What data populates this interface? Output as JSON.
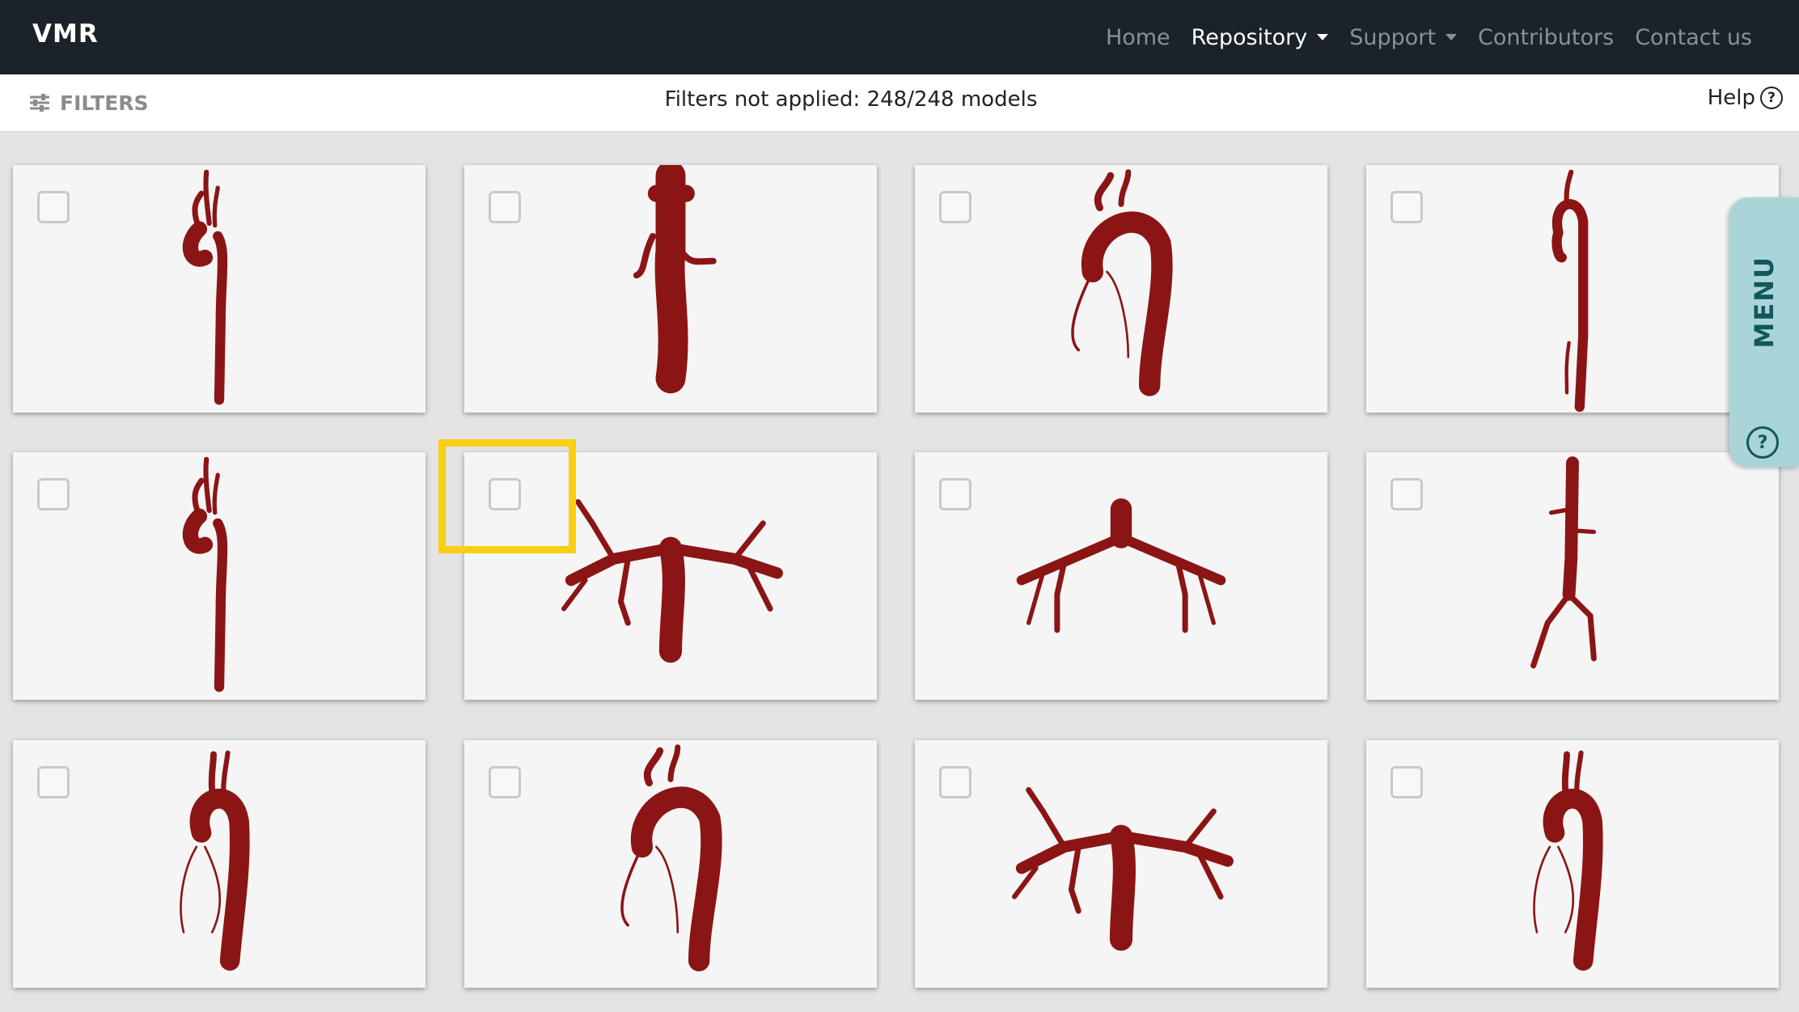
{
  "navbar": {
    "brand": "VMR",
    "links": [
      {
        "label": "Home",
        "active": false,
        "dropdown": false
      },
      {
        "label": "Repository",
        "active": true,
        "dropdown": true
      },
      {
        "label": "Support",
        "active": false,
        "dropdown": true
      },
      {
        "label": "Contributors",
        "active": false,
        "dropdown": false
      },
      {
        "label": "Contact us",
        "active": false,
        "dropdown": false
      }
    ]
  },
  "filterbar": {
    "filters_label": "FILTERS",
    "status": "Filters not applied: 248/248 models",
    "help_label": "Help"
  },
  "side_menu": {
    "label": "MENU",
    "help_icon": "question-circle-icon"
  },
  "colors": {
    "navbar_bg": "#1a2329",
    "vessel": "#8b1515",
    "highlight": "#f8cf12",
    "menu_tab": "#a9d5d8"
  },
  "models": [
    {
      "icon": "aorta-model-icon",
      "checked": false
    },
    {
      "icon": "vena-cava-model-icon",
      "checked": false
    },
    {
      "icon": "aortic-arch-coronary-model-icon",
      "checked": false
    },
    {
      "icon": "thoracic-aorta-model-icon",
      "checked": false
    },
    {
      "icon": "aorta-model-icon",
      "checked": false
    },
    {
      "icon": "pulmonary-tree-model-icon",
      "checked": false
    },
    {
      "icon": "pulmonary-arteries-model-icon",
      "checked": false
    },
    {
      "icon": "abdominal-aorta-model-icon",
      "checked": false
    },
    {
      "icon": "aortic-root-coronary-model-icon",
      "checked": false
    },
    {
      "icon": "aortic-arch-coronary-model-icon",
      "checked": false
    },
    {
      "icon": "pulmonary-tree-model-icon",
      "checked": false
    },
    {
      "icon": "aortic-root-coronary-model-icon",
      "checked": false
    }
  ]
}
